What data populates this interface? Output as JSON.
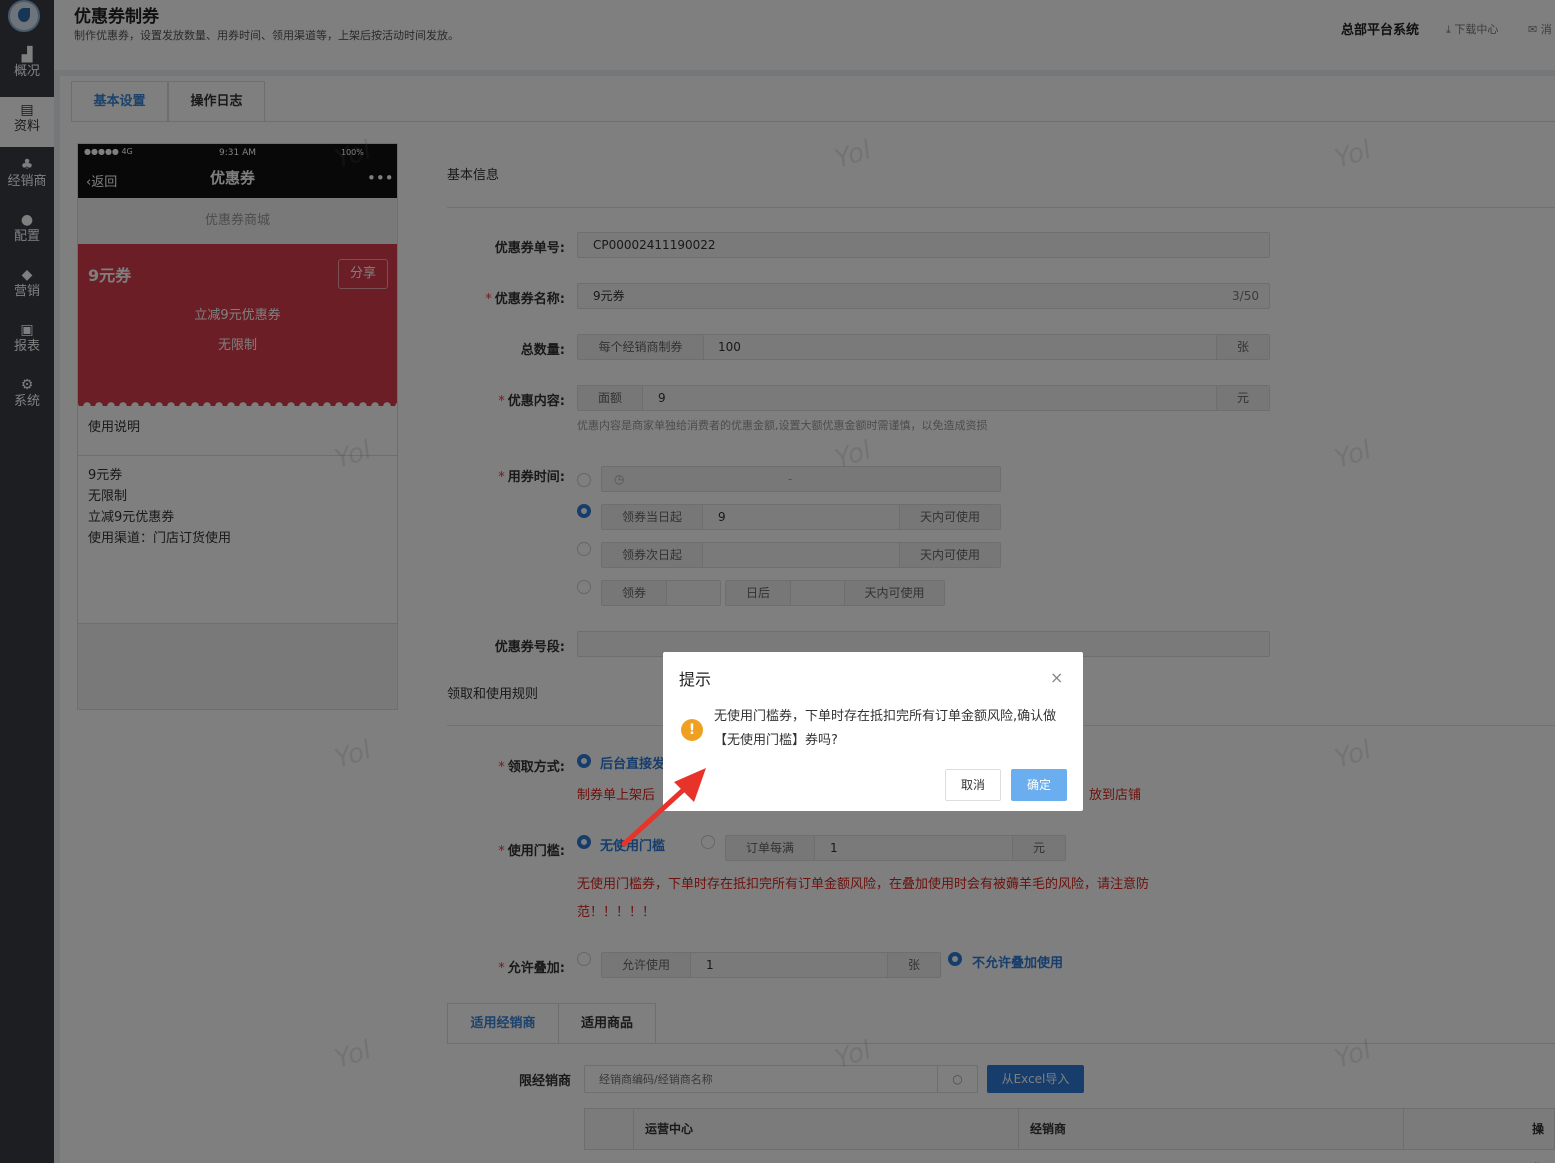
{
  "header": {
    "title": "优惠券制券",
    "subtitle": "制作优惠券，设置发放数量、用券时间、领用渠道等，上架后按活动时间发放。",
    "system": "总部平台系统",
    "download": "下载中心",
    "message": "消"
  },
  "sidebar": {
    "items": [
      {
        "label": "概况",
        "icon": "chart-bar-icon"
      },
      {
        "label": "资料",
        "icon": "document-icon"
      },
      {
        "label": "经销商",
        "icon": "users-icon"
      },
      {
        "label": "配置",
        "icon": "settings-icon"
      },
      {
        "label": "营销",
        "icon": "tag-icon"
      },
      {
        "label": "报表",
        "icon": "report-icon"
      },
      {
        "label": "系统",
        "icon": "gears-icon"
      }
    ]
  },
  "tabs": [
    "基本设置",
    "操作日志"
  ],
  "preview": {
    "signal": "●●●●● 4G",
    "time": "9:31 AM",
    "battery": "100%",
    "back": "返回",
    "title": "优惠券",
    "more": "•••",
    "shop": "优惠券商城",
    "coupon_name": "9元券",
    "share": "分享",
    "desc1": "立减9元优惠券",
    "desc2": "无限制",
    "usage_title": "使用说明",
    "lines": [
      "9元券",
      "无限制",
      "立减9元优惠券",
      "使用渠道：门店订货使用"
    ]
  },
  "form": {
    "section_basic": "基本信息",
    "section_rules": "领取和使用规则",
    "coupon_no_label": "优惠券单号:",
    "coupon_no": "CP00002411190022",
    "name_label": "优惠券名称:",
    "name_value": "9元券",
    "name_count": "3/50",
    "qty_label": "总数量:",
    "qty_prefix": "每个经销商制券",
    "qty_value": "100",
    "qty_unit": "张",
    "content_label": "优惠内容:",
    "content_prefix": "面额",
    "content_value": "9",
    "content_unit": "元",
    "content_hint": "优惠内容是商家单独给消费者的优惠金额,设置大额优惠金额时需谨慎，以免造成资损",
    "time_label": "用券时间:",
    "time_sep": "-",
    "time_opt2_prefix": "领券当日起",
    "time_opt2_value": "9",
    "time_opt2_unit": "天内可使用",
    "time_opt3_prefix": "领券次日起",
    "time_opt3_unit": "天内可使用",
    "time_opt4_a": "领券",
    "time_opt4_b": "日后",
    "time_opt4_c": "天内可使用",
    "segment_label": "优惠券号段:",
    "receive_label": "领取方式:",
    "receive_opt": "后台直接发",
    "receive_note_left": "制券单上架后",
    "receive_note_right": "放到店铺",
    "threshold_label": "使用门槛:",
    "threshold_opt1": "无使用门槛",
    "threshold_prefix": "订单每满",
    "threshold_value": "1",
    "threshold_unit": "元",
    "threshold_warning_1": "无使用门槛券，下单时存在抵扣完所有订单金额风险，在叠加使用时会有被薅羊毛的风险，请注意防",
    "threshold_warning_2": "范！！！！！",
    "stack_label": "允许叠加:",
    "stack_prefix": "允许使用",
    "stack_value": "1",
    "stack_unit": "张",
    "stack_opt2": "不允许叠加使用"
  },
  "subtabs": [
    "适用经销商",
    "适用商品"
  ],
  "dealer": {
    "label": "限经销商",
    "placeholder": "经销商编码/经销商名称",
    "import": "从Excel导入",
    "columns": [
      "运营中心",
      "经销商",
      "操作"
    ]
  },
  "watermark": "Yol",
  "modal": {
    "title": "提示",
    "close": "×",
    "icon": "!",
    "body": "无使用门槛券，下单时存在抵扣完所有订单金额风险,确认做【无使用门槛】券吗?",
    "cancel": "取消",
    "ok": "确定"
  }
}
